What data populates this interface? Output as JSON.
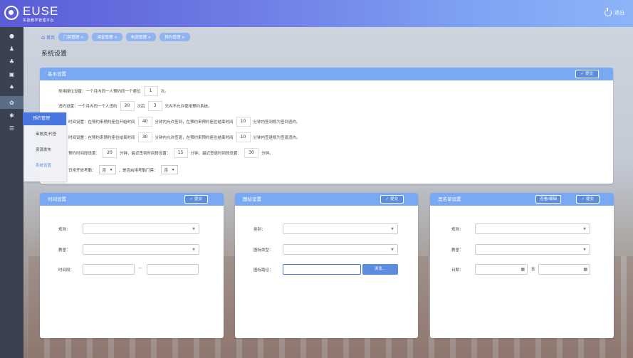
{
  "header": {
    "logo_text": "EUSE",
    "logo_sub": "实验教学管理平台",
    "logout_label": "退出"
  },
  "sidebar": {
    "icons": [
      "user-icon",
      "person-icon",
      "group-icon",
      "book-icon",
      "stamp-icon",
      "reserve-icon",
      "gear-icon",
      "list-icon"
    ]
  },
  "flyout": {
    "title": "预约管理",
    "items": [
      "审核类/代签",
      "资源发布",
      "系统设置"
    ]
  },
  "breadcrumb": {
    "home": "首页",
    "tabs": [
      "门禁管理 ×",
      "课堂管理 ×",
      "电源管理 ×",
      "预约管理 ×"
    ]
  },
  "page_title": "系统设置",
  "basic": {
    "title": "基本设置",
    "submit": "提交",
    "r1a": "常用座位设置：一个月内同一人预约同一个座位",
    "r1v": "1",
    "r1b": "次。",
    "r2a": "违约设置：一个月内同一个人违约",
    "r2v1": "20",
    "r2b": "次后",
    "r2v2": "3",
    "r2c": "天内不允许使用预约系统。",
    "r3a": "时间设置：在预约来预约座位开始时间",
    "r3v1": "40",
    "r3b": "分钟内允许签到，在预约来预约座位结束时间",
    "r3v2": "10",
    "r3c": "分钟内签到视为签到违约。",
    "r4a": "时间设置：在预约来预约座位结束时间",
    "r4v1": "30",
    "r4b": "分钟内允许签退，在预约来预约座位结束时间",
    "r4v2": "10",
    "r4c": "分钟内签退视为签退违约。",
    "r5a": "预约时间段设置：",
    "r5v1": "20",
    "r5b": "分钟，最近签到时间段设置：",
    "r5v2": "15",
    "r5c": "分钟，最近签退时间段设置：",
    "r5v3": "30",
    "r5d": "分钟。",
    "r6a": "日常开放考勤：",
    "r6v1": "否",
    "r6b": "，是否启用考勤门禁：",
    "r6v2": "否"
  },
  "time_panel": {
    "title": "时间设置",
    "submit": "提交",
    "lbl1": "规则：",
    "lbl2": "教室：",
    "lbl3": "时间段：",
    "dash": "—"
  },
  "icon_panel": {
    "title": "图标设置",
    "submit": "提交",
    "lbl1": "类别：",
    "lbl2": "图标类型：",
    "lbl3": "图标路径：",
    "browse": "浏览..."
  },
  "black_panel": {
    "title": "黑名单设置",
    "view": "查看/编辑",
    "submit": "提交",
    "lbl1": "规则：",
    "lbl2": "教室：",
    "lbl3": "日期：",
    "to": "至"
  }
}
